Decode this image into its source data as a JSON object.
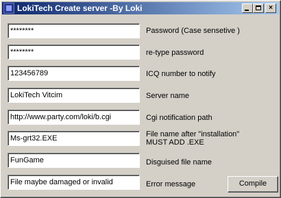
{
  "window": {
    "title": "LokiTech Create server -By Loki",
    "minimize": "_",
    "maximize": "□",
    "close": "×"
  },
  "fields": [
    {
      "value": "********",
      "label": "Password (Case sensetive )"
    },
    {
      "value": "********",
      "label": "re-type password"
    },
    {
      "value": "123456789",
      "label": "ICQ number to notify"
    },
    {
      "value": "LokiTech Vitcim",
      "label": "Server name"
    },
    {
      "value": "http://www.party.com/loki/b.cgi",
      "label": "Cgi notification path"
    },
    {
      "value": "Ms-grt32.EXE",
      "label_line1": "File name after \"installation\"",
      "label_line2": "MUST ADD .EXE"
    },
    {
      "value": "FunGame",
      "label": "Disguised file name"
    },
    {
      "value": "File maybe damaged or invalid",
      "label": "Error message"
    }
  ],
  "compile_button": "Compile"
}
